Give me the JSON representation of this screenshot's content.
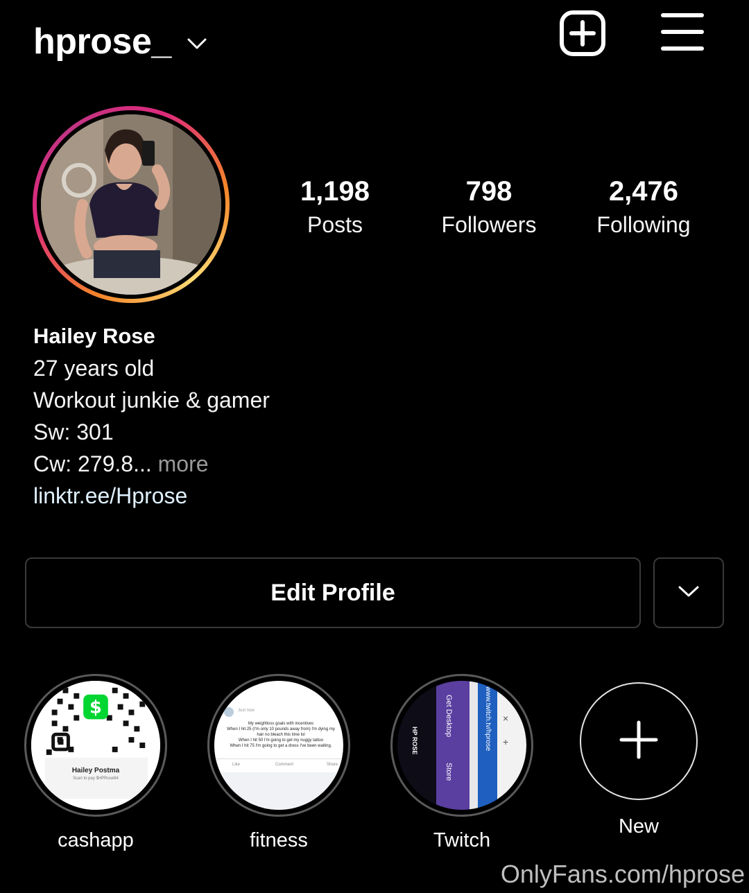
{
  "header": {
    "username": "hprose_",
    "icons": [
      "chevron-down-icon",
      "new-post-icon",
      "menu-icon"
    ]
  },
  "stats": {
    "posts": {
      "value": "1,198",
      "label": "Posts"
    },
    "followers": {
      "value": "798",
      "label": "Followers"
    },
    "following": {
      "value": "2,476",
      "label": "Following"
    }
  },
  "bio": {
    "name": "Hailey Rose",
    "lines": [
      "27 years old",
      "Workout junkie & gamer",
      "Sw: 301",
      "Cw: 279.8"
    ],
    "ellipsis": "...",
    "more": " more",
    "link": "linktr.ee/Hprose"
  },
  "actions": {
    "edit_profile": "Edit Profile"
  },
  "highlights": [
    {
      "label": "cashapp",
      "thumb_text": "Hailey Postma",
      "thumb_sub": "Scan to pay $HPRose94"
    },
    {
      "label": "fitness"
    },
    {
      "label": "Twitch"
    },
    {
      "label": "New"
    }
  ],
  "fitness_thumb": {
    "time": "Just now",
    "lines": [
      "My weightloss goals with incentives",
      "When I hit 25 (I'm only 10 pounds away from) I'm dying my",
      "hair no bleach this time lol",
      "When I hit 50 I'm going to get my nuggy tattoo",
      "When I hit 75 I'm going to get a dress I've been waiting."
    ],
    "actions": [
      "Like",
      "Comment",
      "Share"
    ]
  },
  "twitch_thumb": {
    "url": "www.twitch.tv/hprose",
    "text1": "Get Desktop",
    "text2": "Store",
    "logo": "HP ROSE"
  },
  "watermark": "OnlyFans.com/hprose",
  "colors": {
    "background": "#000000",
    "text": "#f5f5f5",
    "muted": "#9a9a9a",
    "link": "#e0f1ff",
    "border": "#3a3a3a",
    "cashapp_green": "#00d632",
    "twitch_purple": "#6441a5"
  }
}
